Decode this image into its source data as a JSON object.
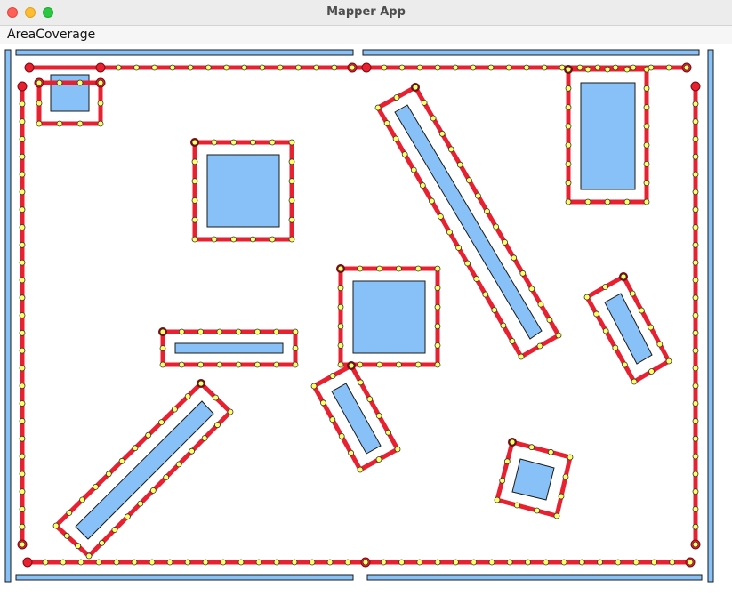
{
  "window": {
    "title": "Mapper App"
  },
  "menubar": {
    "items": [
      {
        "label": "AreaCoverage"
      }
    ]
  },
  "colors": {
    "obstacle_fill": "#87c1f7",
    "obstacle_stroke": "#1a1a1a",
    "path": "#e8202f",
    "waypoint": "#ffff66",
    "window_bg": "#ffffff"
  }
}
